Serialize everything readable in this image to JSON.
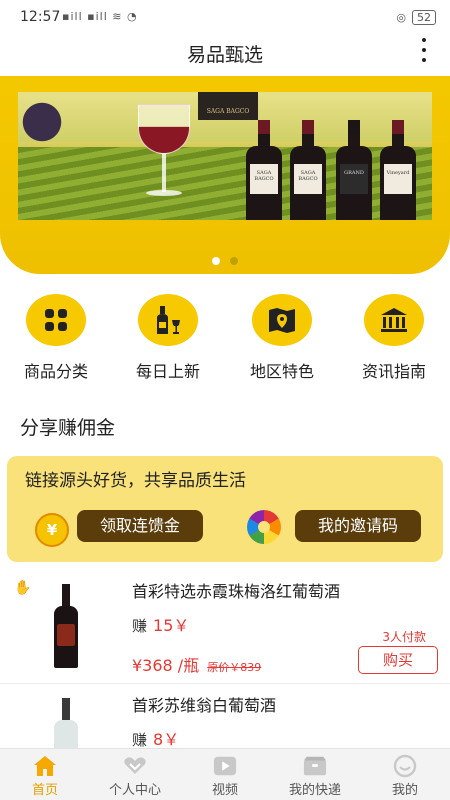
{
  "status_bar": {
    "time": "12:57",
    "signal": "▪ill ▪ill ≋ ◔",
    "battery": "52"
  },
  "app_bar": {
    "title": "易品甄选",
    "more_icon": "more-vertical-icon"
  },
  "banner": {
    "slides": 2,
    "active_slide": 1,
    "brand_logo": "SAGA BAGCO",
    "bottle_labels": [
      "SAGA BAGCO",
      "SAGA BAGCO",
      "GRAND",
      "Vineyard"
    ]
  },
  "categories": [
    {
      "label": "商品分类",
      "icon": "grid-icon"
    },
    {
      "label": "每日上新",
      "icon": "wine-bottle-icon"
    },
    {
      "label": "地区特色",
      "icon": "map-pin-icon"
    },
    {
      "label": "资讯指南",
      "icon": "bank-building-icon"
    }
  ],
  "section": {
    "title": "分享赚佣金"
  },
  "promo": {
    "slogan": "链接源头好货，共享品质生活",
    "coin_symbol": "¥",
    "claim_button": "领取连馈金",
    "invite_button": "我的邀请码"
  },
  "products": [
    {
      "name": "首彩特选赤霞珠梅洛红葡萄酒",
      "earn_label": "赚",
      "earn_amount": "15￥",
      "price": "¥368 /瓶",
      "original_price": "原价￥839",
      "paid_count": "3人付款",
      "buy_label": "购买"
    },
    {
      "name": "首彩苏维翁白葡萄酒",
      "earn_label": "赚",
      "earn_amount": "8￥"
    }
  ],
  "tabbar": [
    {
      "label": "首页",
      "icon": "home-icon",
      "active": true
    },
    {
      "label": "个人中心",
      "icon": "heart-chevron-icon",
      "active": false
    },
    {
      "label": "视频",
      "icon": "play-icon",
      "active": false
    },
    {
      "label": "我的快递",
      "icon": "package-icon",
      "active": false
    },
    {
      "label": "我的",
      "icon": "smiley-icon",
      "active": false
    }
  ],
  "colors": {
    "brand_yellow": "#f7c900",
    "promo_bg": "#f9e27a",
    "button_brown": "#5b3d0b",
    "price_red": "#e53935",
    "active_tab": "#e5a000"
  }
}
